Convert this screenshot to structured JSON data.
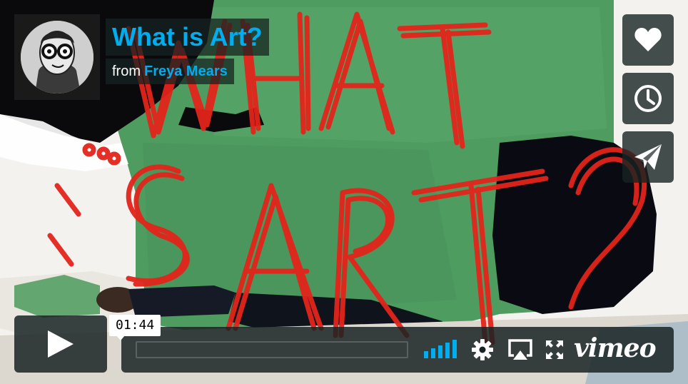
{
  "video": {
    "title": "What is Art?",
    "byline_prefix": "from",
    "author": "Freya Mears",
    "frame_text": "WHAT IS ART?"
  },
  "controls": {
    "timecode": "01:44",
    "progress": 0.0,
    "volume_level": 1.0,
    "brand": "vimeo"
  },
  "icons": {
    "like": "heart-icon",
    "watch_later": "clock-icon",
    "share": "paper-plane-icon",
    "play": "play-icon",
    "settings": "gear-icon",
    "airplay": "airplay-icon",
    "fullscreen": "fullscreen-icon"
  },
  "colors": {
    "accent": "#00adef",
    "overlay": "#172322",
    "scene_green": "#4e9a5e",
    "scene_red": "#e3241b"
  }
}
